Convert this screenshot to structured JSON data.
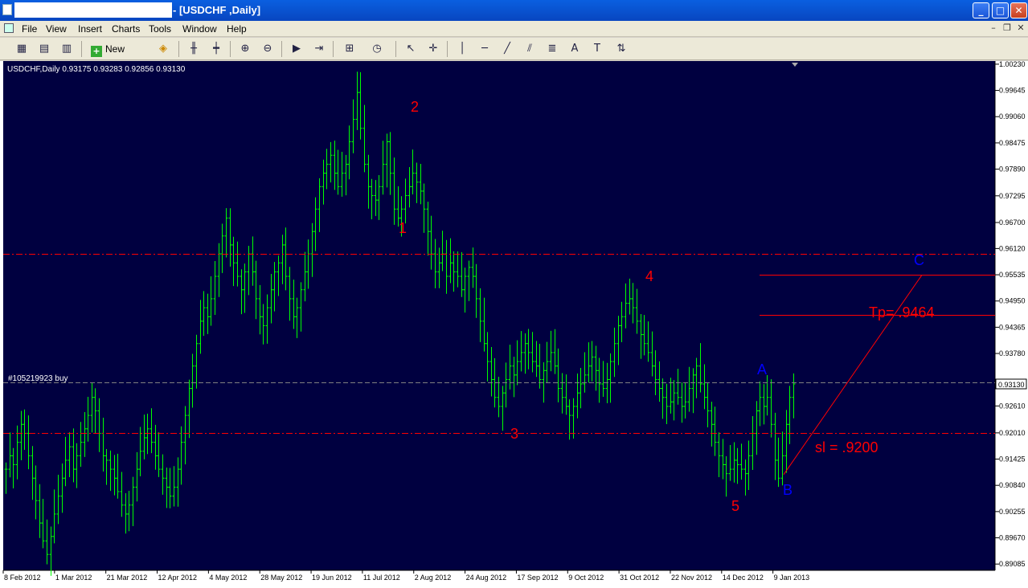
{
  "window": {
    "title": "- [USDCHF ,Daily]"
  },
  "menu": [
    "File",
    "View",
    "Insert",
    "Charts",
    "Tools",
    "Window",
    "Help"
  ],
  "toolbar": {
    "new_order_label": "New Order",
    "tab_count": "4"
  },
  "chart_header": {
    "symbol_info": "USDCHF,Daily  0.93175 0.93283 0.92856 0.93130",
    "order_label": "#105219923 buy"
  },
  "colors": {
    "background": "#000040",
    "bars": "#00ff00",
    "grid_line": "#ff0000",
    "wave_label": "#ff0000",
    "abc_label": "#0000ff",
    "order_line": "#808080"
  },
  "chart_data": {
    "type": "ohlc",
    "symbol": "USDCHF",
    "timeframe": "Daily",
    "last_bar": {
      "open": 0.93175,
      "high": 0.93283,
      "low": 0.92856,
      "close": 0.9313
    },
    "current_price": "0.93130",
    "y_ticks": [
      "1.00230",
      "0.99645",
      "0.99060",
      "0.98475",
      "0.97890",
      "0.97295",
      "0.96700",
      "0.96120",
      "0.95535",
      "0.94950",
      "0.94365",
      "0.93780",
      "0.93130",
      "0.92610",
      "0.92010",
      "0.91425",
      "0.90840",
      "0.90255",
      "0.89670",
      "0.89085"
    ],
    "x_ticks": [
      "8 Feb 2012",
      "1 Mar 2012",
      "21 Mar 2012",
      "12 Apr 2012",
      "4 May 2012",
      "28 May 2012",
      "19 Jun 2012",
      "11 Jul 2012",
      "2 Aug 2012",
      "24 Aug 2012",
      "17 Sep 2012",
      "9 Oct 2012",
      "31 Oct 2012",
      "22 Nov 2012",
      "14 Dec 2012",
      "9 Jan 2013"
    ],
    "ylim": [
      0.88945,
      1.003
    ],
    "series_closes": [
      0.912,
      0.915,
      0.913,
      0.918,
      0.922,
      0.92,
      0.915,
      0.91,
      0.905,
      0.9,
      0.896,
      0.893,
      0.897,
      0.902,
      0.906,
      0.91,
      0.914,
      0.917,
      0.912,
      0.915,
      0.918,
      0.921,
      0.924,
      0.928,
      0.925,
      0.92,
      0.915,
      0.914,
      0.912,
      0.91,
      0.907,
      0.904,
      0.902,
      0.904,
      0.908,
      0.912,
      0.916,
      0.919,
      0.921,
      0.918,
      0.915,
      0.912,
      0.91,
      0.908,
      0.906,
      0.908,
      0.912,
      0.918,
      0.924,
      0.93,
      0.935,
      0.94,
      0.945,
      0.948,
      0.946,
      0.95,
      0.955,
      0.96,
      0.964,
      0.968,
      0.962,
      0.958,
      0.955,
      0.952,
      0.956,
      0.96,
      0.956,
      0.95,
      0.946,
      0.944,
      0.948,
      0.952,
      0.956,
      0.958,
      0.962,
      0.955,
      0.95,
      0.946,
      0.948,
      0.952,
      0.956,
      0.96,
      0.965,
      0.97,
      0.975,
      0.978,
      0.98,
      0.982,
      0.978,
      0.975,
      0.978,
      0.98,
      0.985,
      0.99,
      0.996,
      0.988,
      0.98,
      0.975,
      0.973,
      0.972,
      0.975,
      0.98,
      0.985,
      0.978,
      0.97,
      0.968,
      0.97,
      0.973,
      0.975,
      0.978,
      0.976,
      0.974,
      0.97,
      0.965,
      0.96,
      0.956,
      0.958,
      0.96,
      0.955,
      0.958,
      0.956,
      0.955,
      0.952,
      0.955,
      0.957,
      0.955,
      0.95,
      0.945,
      0.94,
      0.936,
      0.932,
      0.928,
      0.926,
      0.929,
      0.932,
      0.935,
      0.933,
      0.936,
      0.938,
      0.94,
      0.938,
      0.936,
      0.935,
      0.932,
      0.934,
      0.936,
      0.938,
      0.935,
      0.93,
      0.928,
      0.926,
      0.924,
      0.926,
      0.929,
      0.931,
      0.933,
      0.935,
      0.937,
      0.934,
      0.931,
      0.93,
      0.932,
      0.936,
      0.94,
      0.944,
      0.946,
      0.949,
      0.95,
      0.948,
      0.945,
      0.942,
      0.94,
      0.938,
      0.935,
      0.932,
      0.93,
      0.928,
      0.926,
      0.927,
      0.929,
      0.928,
      0.926,
      0.927,
      0.93,
      0.933,
      0.935,
      0.931,
      0.928,
      0.925,
      0.922,
      0.918,
      0.915,
      0.913,
      0.911,
      0.912,
      0.914,
      0.913,
      0.912,
      0.911,
      0.915,
      0.92,
      0.925,
      0.928,
      0.926,
      0.928,
      0.922,
      0.914,
      0.91,
      0.915,
      0.922,
      0.928,
      0.931
    ],
    "horizontal_lines": [
      {
        "price": 0.96,
        "style": "dash-dot",
        "color": "#ff0000"
      },
      {
        "price": 0.92,
        "style": "dash-dot",
        "color": "#ff0000"
      },
      {
        "price": 0.9313,
        "style": "dashed",
        "color": "#808080",
        "label": "#105219923 buy"
      },
      {
        "price": 0.9554,
        "style": "solid",
        "color": "#ff0000",
        "from_date": "17 Dec 2012"
      },
      {
        "price": 0.9464,
        "style": "solid",
        "color": "#ff0000",
        "from_date": "17 Dec 2012"
      }
    ],
    "trend_line": {
      "from": {
        "date": "9 Jan 2013",
        "price": 0.9108
      },
      "to": {
        "date": "C",
        "price": 0.9553
      },
      "color": "#ff0000"
    },
    "annotations": [
      {
        "text": "1",
        "color": "#ff0000"
      },
      {
        "text": "2",
        "color": "#ff0000"
      },
      {
        "text": "3",
        "color": "#ff0000"
      },
      {
        "text": "4",
        "color": "#ff0000"
      },
      {
        "text": "5",
        "color": "#ff0000"
      },
      {
        "text": "A",
        "color": "#0000ff"
      },
      {
        "text": "B",
        "color": "#0000ff"
      },
      {
        "text": "C",
        "color": "#0000ff"
      },
      {
        "text": "Tp= .9464",
        "color": "#ff0000"
      },
      {
        "text": "sl = .9200",
        "color": "#ff0000"
      }
    ]
  }
}
